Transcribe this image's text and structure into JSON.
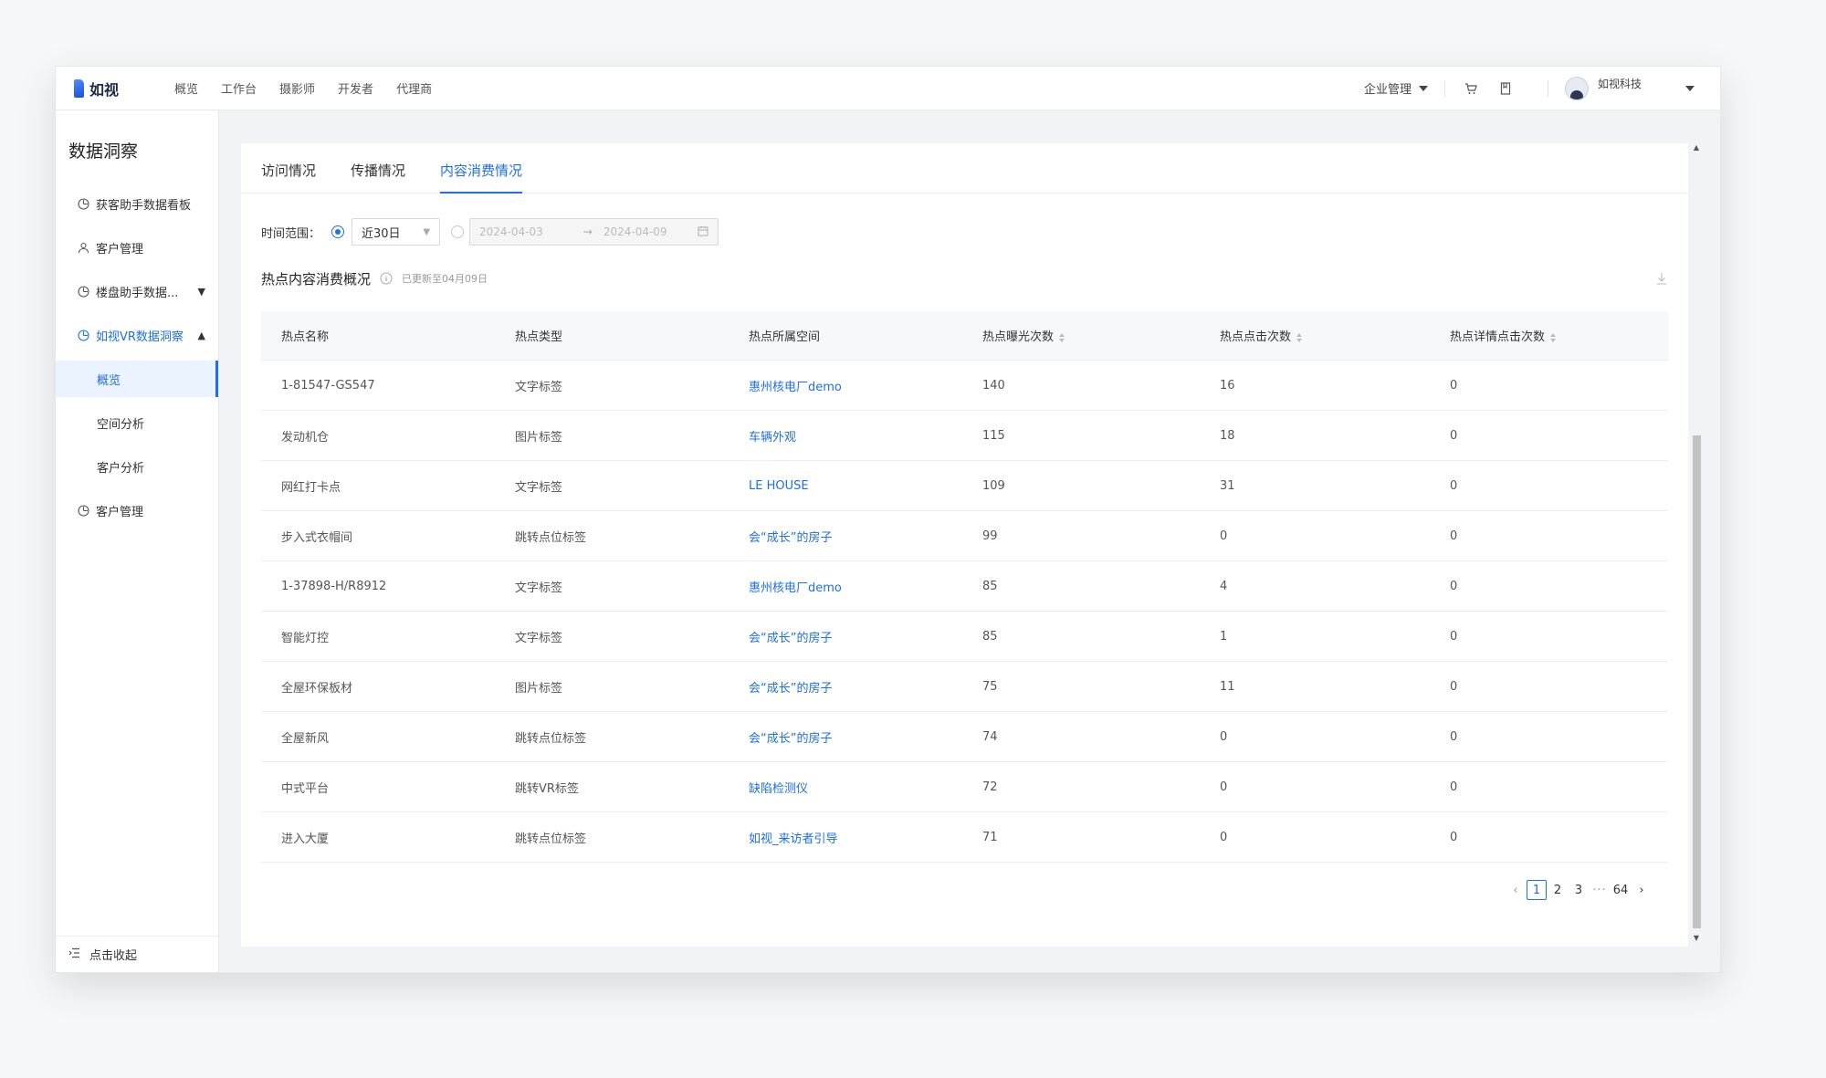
{
  "app": {
    "logo_text": "如视",
    "nav": [
      "概览",
      "工作台",
      "摄影师",
      "开发者",
      "代理商"
    ],
    "enterprise": "企业管理",
    "user_name": "如视科技"
  },
  "sidebar": {
    "title": "数据洞察",
    "items": [
      {
        "label": "获客助手数据看板",
        "icon": "chart-icon"
      },
      {
        "label": "客户管理",
        "icon": "user-icon"
      },
      {
        "label": "楼盘助手数据...",
        "icon": "chart-icon",
        "chevron": "down"
      },
      {
        "label": "如视VR数据洞察",
        "icon": "chart-icon",
        "chevron": "up",
        "active": true
      }
    ],
    "subitems": [
      "概览",
      "空间分析",
      "客户分析"
    ],
    "last_item": {
      "label": "客户管理",
      "icon": "chart-icon"
    },
    "collapse_label": "点击收起"
  },
  "tabs": [
    "访问情况",
    "传播情况",
    "内容消费情况"
  ],
  "filter": {
    "label": "时间范围：",
    "preset": "近30日",
    "range_start": "2024-04-03",
    "range_end": "2024-04-09"
  },
  "section": {
    "title": "热点内容消费概况",
    "updated": "已更新至04月09日"
  },
  "table": {
    "headers": [
      "热点名称",
      "热点类型",
      "热点所属空间",
      "热点曝光次数",
      "热点点击次数",
      "热点详情点击次数"
    ],
    "rows": [
      [
        "1-81547-GS547",
        "文字标签",
        "惠州核电厂demo",
        "140",
        "16",
        "0"
      ],
      [
        "发动机仓",
        "图片标签",
        "车辆外观",
        "115",
        "18",
        "0"
      ],
      [
        "网红打卡点",
        "文字标签",
        "LE HOUSE",
        "109",
        "31",
        "0"
      ],
      [
        "步入式衣帽间",
        "跳转点位标签",
        "会“成长”的房子",
        "99",
        "0",
        "0"
      ],
      [
        "1-37898-H/R8912",
        "文字标签",
        "惠州核电厂demo",
        "85",
        "4",
        "0"
      ],
      [
        "智能灯控",
        "文字标签",
        "会“成长”的房子",
        "85",
        "1",
        "0"
      ],
      [
        "全屋环保板材",
        "图片标签",
        "会“成长”的房子",
        "75",
        "11",
        "0"
      ],
      [
        "全屋新风",
        "跳转点位标签",
        "会“成长”的房子",
        "74",
        "0",
        "0"
      ],
      [
        "中式平台",
        "跳转VR标签",
        "缺陷检测仪",
        "72",
        "0",
        "0"
      ],
      [
        "进入大厦",
        "跳转点位标签",
        "如视_来访者引导",
        "71",
        "0",
        "0"
      ]
    ]
  },
  "pager": {
    "pages": [
      "1",
      "2",
      "3"
    ],
    "ellipsis": "···",
    "last": "64",
    "prev": "‹",
    "next": "›"
  },
  "colors": {
    "accent": "#1f6fe5"
  }
}
